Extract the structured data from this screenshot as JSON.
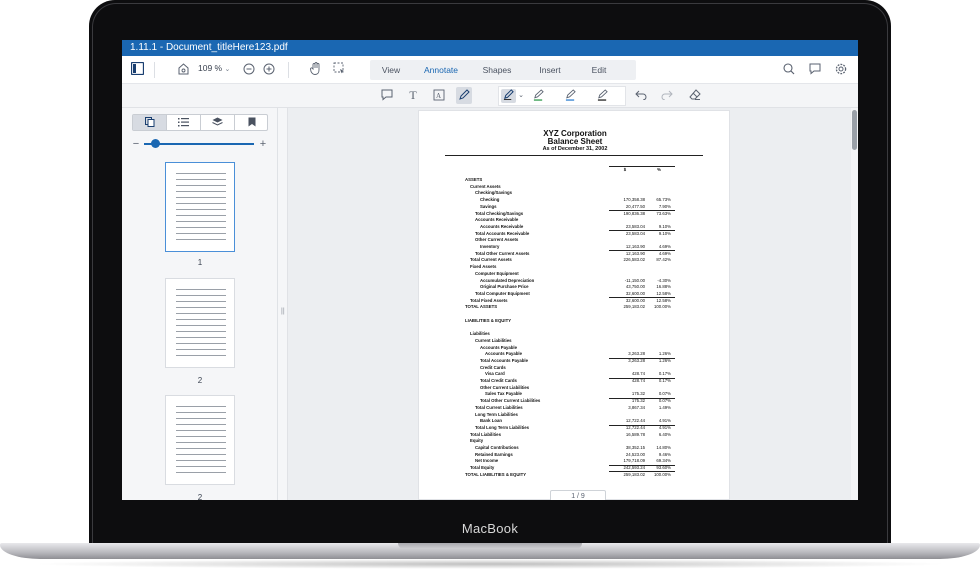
{
  "device": {
    "brand": "MacBook"
  },
  "app": {
    "window_title": "1.11.1 - Document_titleHere123.pdf",
    "zoom": "109 %",
    "tabs": [
      {
        "label": "View",
        "active": false
      },
      {
        "label": "Annotate",
        "active": true
      },
      {
        "label": "Shapes",
        "active": false
      },
      {
        "label": "Insert",
        "active": false
      },
      {
        "label": "Edit",
        "active": false
      }
    ],
    "accent_color": "#1a67b2",
    "pen_colors": [
      "#333333",
      "#2e9a4a",
      "#2f7fd0",
      "#222222"
    ]
  },
  "sidebar": {
    "thumbnail_labels": [
      "1",
      "2",
      "2"
    ],
    "thumb_size_fraction": 0.1
  },
  "pager": {
    "text": "1 / 9"
  },
  "document": {
    "company": "XYZ Corporation",
    "title": "Balance Sheet",
    "date": "As of December 31, 2002",
    "col1": "$",
    "col2": "%",
    "rows": [
      {
        "label": "ASSETS",
        "indent": 0,
        "v1": "",
        "v2": ""
      },
      {
        "label": "Current Assets",
        "indent": 1,
        "v1": "",
        "v2": ""
      },
      {
        "label": "Checking/Savings",
        "indent": 2,
        "v1": "",
        "v2": ""
      },
      {
        "label": "Checking",
        "indent": 3,
        "v1": "170,358.38",
        "v2": "65.73%"
      },
      {
        "label": "Savings",
        "indent": 3,
        "v1": "20,477.50",
        "v2": "7.90%"
      },
      {
        "label": "Total Checking/Savings",
        "indent": 2,
        "v1": "190,836.38",
        "v2": "73.63%"
      },
      {
        "label": "Accounts Receivable",
        "indent": 2,
        "v1": "",
        "v2": ""
      },
      {
        "label": "Accounts Receivable",
        "indent": 3,
        "v1": "23,583.04",
        "v2": "9.10%"
      },
      {
        "label": "Total Accounts Receivable",
        "indent": 2,
        "v1": "23,583.04",
        "v2": "9.10%"
      },
      {
        "label": "Other Current Assets",
        "indent": 2,
        "v1": "",
        "v2": ""
      },
      {
        "label": "Inventory",
        "indent": 3,
        "v1": "12,163.90",
        "v2": "4.69%"
      },
      {
        "label": "Total Other Current Assets",
        "indent": 2,
        "v1": "12,163.90",
        "v2": "4.69%"
      },
      {
        "label": "Total Current Assets",
        "indent": 1,
        "v1": "226,583.02",
        "v2": "87.42%"
      },
      {
        "label": "Fixed Assets",
        "indent": 1,
        "v1": "",
        "v2": ""
      },
      {
        "label": "Computer Equipment",
        "indent": 2,
        "v1": "",
        "v2": ""
      },
      {
        "label": "Accumulated Depreciation",
        "indent": 3,
        "v1": "-11,150.00",
        "v2": "-4.30%"
      },
      {
        "label": "Original Purchase Price",
        "indent": 3,
        "v1": "43,750.00",
        "v2": "16.88%"
      },
      {
        "label": "Total Computer Equipment",
        "indent": 2,
        "v1": "32,600.00",
        "v2": "12.58%"
      },
      {
        "label": "Total Fixed Assets",
        "indent": 1,
        "v1": "32,600.00",
        "v2": "12.58%"
      },
      {
        "label": "TOTAL ASSETS",
        "indent": 0,
        "v1": "259,183.02",
        "v2": "100.00%"
      },
      {
        "label": "",
        "indent": 0,
        "v1": "",
        "v2": ""
      },
      {
        "label": "LIABILITIES & EQUITY",
        "indent": 0,
        "v1": "",
        "v2": ""
      },
      {
        "label": "",
        "indent": 0,
        "v1": "",
        "v2": ""
      },
      {
        "label": "Liabilities",
        "indent": 1,
        "v1": "",
        "v2": ""
      },
      {
        "label": "Current Liabilities",
        "indent": 2,
        "v1": "",
        "v2": ""
      },
      {
        "label": "Accounts Payable",
        "indent": 3,
        "v1": "",
        "v2": ""
      },
      {
        "label": "Accounts Payable",
        "indent": 4,
        "v1": "3,263.28",
        "v2": "1.26%"
      },
      {
        "label": "Total Accounts Payable",
        "indent": 3,
        "v1": "3,263.28",
        "v2": "1.26%"
      },
      {
        "label": "Credit Cards",
        "indent": 3,
        "v1": "",
        "v2": ""
      },
      {
        "label": "Visa Card",
        "indent": 4,
        "v1": "428.74",
        "v2": "0.17%"
      },
      {
        "label": "Total Credit Cards",
        "indent": 3,
        "v1": "428.74",
        "v2": "0.17%"
      },
      {
        "label": "Other Current Liabilities",
        "indent": 3,
        "v1": "",
        "v2": ""
      },
      {
        "label": "Sales Tax Payable",
        "indent": 4,
        "v1": "175.32",
        "v2": "0.07%"
      },
      {
        "label": "Total Other Current Liabilities",
        "indent": 3,
        "v1": "175.32",
        "v2": "0.07%"
      },
      {
        "label": "Total Current Liabilities",
        "indent": 2,
        "v1": "3,867.34",
        "v2": "1.49%"
      },
      {
        "label": "Long Term Liabilities",
        "indent": 2,
        "v1": "",
        "v2": ""
      },
      {
        "label": "Bank Loan",
        "indent": 3,
        "v1": "12,722.44",
        "v2": "4.91%"
      },
      {
        "label": "Total Long Term Liabilities",
        "indent": 2,
        "v1": "12,722.44",
        "v2": "4.91%"
      },
      {
        "label": "Total Liabilities",
        "indent": 1,
        "v1": "16,589.78",
        "v2": "6.40%"
      },
      {
        "label": "Equity",
        "indent": 1,
        "v1": "",
        "v2": ""
      },
      {
        "label": "Capital Contributions",
        "indent": 2,
        "v1": "38,352.15",
        "v2": "14.80%"
      },
      {
        "label": "Retained Earnings",
        "indent": 2,
        "v1": "24,523.00",
        "v2": "9.46%"
      },
      {
        "label": "Net Income",
        "indent": 2,
        "v1": "179,718.09",
        "v2": "69.34%"
      },
      {
        "label": "Total Equity",
        "indent": 1,
        "v1": "242,593.24",
        "v2": "93.60%"
      },
      {
        "label": "TOTAL LIABILITIES & EQUITY",
        "indent": 0,
        "v1": "259,183.02",
        "v2": "100.00%"
      }
    ]
  }
}
